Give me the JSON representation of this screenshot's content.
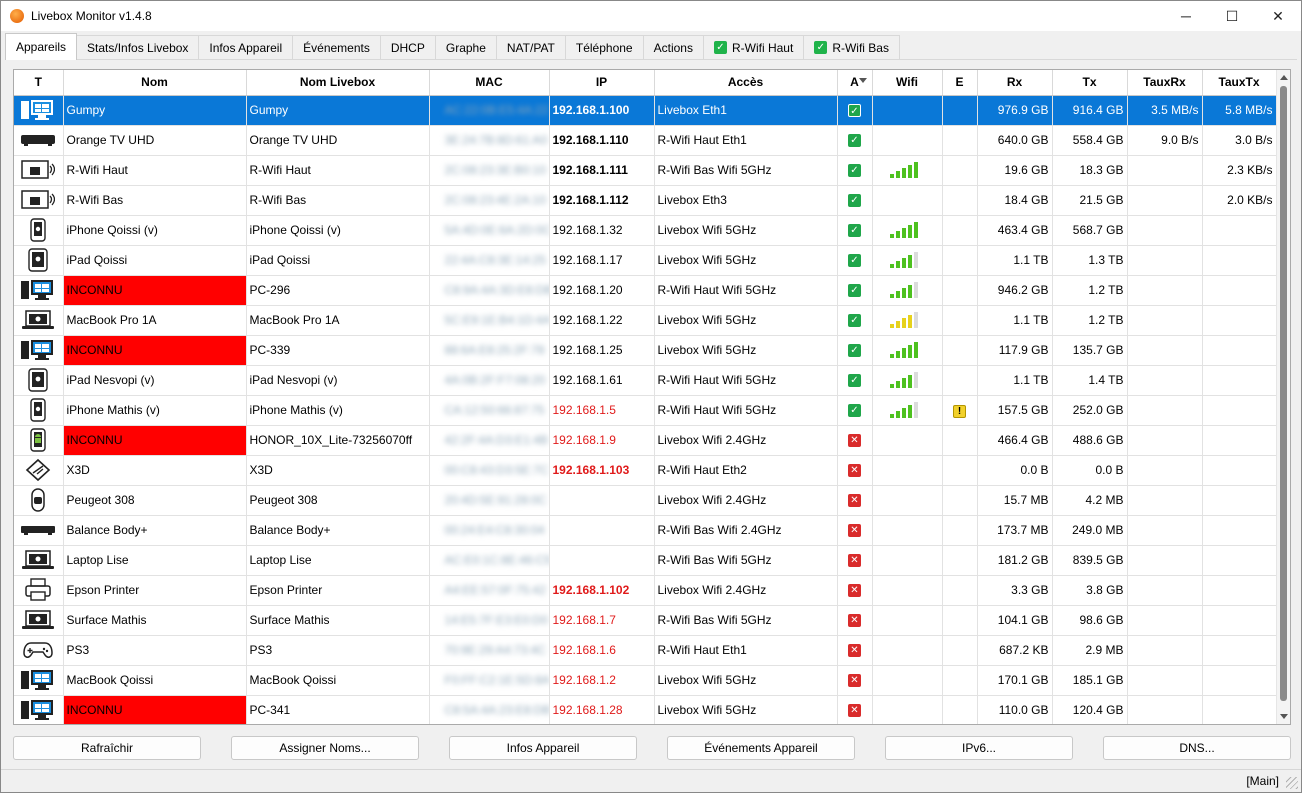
{
  "window": {
    "title": "Livebox Monitor v1.4.8",
    "minimize": "─",
    "maximize": "☐",
    "close": "✕"
  },
  "tabs": [
    {
      "label": "Appareils",
      "active": true
    },
    {
      "label": "Stats/Infos Livebox"
    },
    {
      "label": "Infos Appareil"
    },
    {
      "label": "Événements"
    },
    {
      "label": "DHCP"
    },
    {
      "label": "Graphe"
    },
    {
      "label": "NAT/PAT"
    },
    {
      "label": "Téléphone"
    },
    {
      "label": "Actions"
    },
    {
      "label": "R-Wifi Haut",
      "checked": true
    },
    {
      "label": "R-Wifi Bas",
      "checked": true
    }
  ],
  "table": {
    "columns": [
      "T",
      "Nom",
      "Nom Livebox",
      "MAC",
      "IP",
      "Accès",
      "A",
      "Wifi",
      "E",
      "Rx",
      "Tx",
      "TauxRx",
      "TauxTx"
    ],
    "rows": [
      {
        "icon": "pc",
        "nom": "Gumpy",
        "livebox": "Gumpy",
        "mac": "AC:22:0B:E5:4A:22",
        "ip": "192.168.1.100",
        "ipstyle": "bold",
        "acces": "Livebox Eth1",
        "a": "ok",
        "wifi": 0,
        "e": "",
        "rx": "976.9 GB",
        "tx": "916.4 GB",
        "trx": "3.5 MB/s",
        "ttx": "5.8 MB/s",
        "selected": true
      },
      {
        "icon": "tvbox",
        "nom": "Orange TV UHD",
        "livebox": "Orange TV UHD",
        "mac": "3E:24:7B:8D:61:A0",
        "ip": "192.168.1.110",
        "ipstyle": "bold",
        "acces": "R-Wifi Haut Eth1",
        "a": "ok",
        "wifi": 0,
        "e": "",
        "rx": "640.0 GB",
        "tx": "558.4 GB",
        "trx": "9.0 B/s",
        "ttx": "3.0 B/s"
      },
      {
        "icon": "repeater",
        "nom": "R-Wifi Haut",
        "livebox": "R-Wifi Haut",
        "mac": "2C:08:23:3E:B0:10",
        "ip": "192.168.1.111",
        "ipstyle": "bold",
        "acces": "R-Wifi Bas Wifi 5GHz",
        "a": "ok",
        "wifi": 5,
        "wific": "g",
        "e": "",
        "rx": "19.6 GB",
        "tx": "18.3 GB",
        "trx": "",
        "ttx": "2.3 KB/s"
      },
      {
        "icon": "repeater",
        "nom": "R-Wifi Bas",
        "livebox": "R-Wifi Bas",
        "mac": "2C:08:23:4E:2A:10",
        "ip": "192.168.1.112",
        "ipstyle": "bold",
        "acces": "Livebox Eth3",
        "a": "ok",
        "wifi": 0,
        "e": "",
        "rx": "18.4 GB",
        "tx": "21.5 GB",
        "trx": "",
        "ttx": "2.0 KB/s"
      },
      {
        "icon": "phone",
        "nom": "iPhone Qoissi (v)",
        "livebox": "iPhone Qoissi (v)",
        "mac": "5A:4D:0E:6A:2D:0C",
        "ip": "192.168.1.32",
        "ipstyle": "",
        "acces": "Livebox Wifi 5GHz",
        "a": "ok",
        "wifi": 5,
        "wific": "g",
        "e": "",
        "rx": "463.4 GB",
        "tx": "568.7 GB",
        "trx": "",
        "ttx": ""
      },
      {
        "icon": "tablet",
        "nom": "iPad Qoissi",
        "livebox": "iPad Qoissi",
        "mac": "22:4A:C8:3E:14:25",
        "ip": "192.168.1.17",
        "ipstyle": "",
        "acces": "Livebox Wifi 5GHz",
        "a": "ok",
        "wifi": 4,
        "wific": "g",
        "e": "",
        "rx": "1.1 TB",
        "tx": "1.3 TB",
        "trx": "",
        "ttx": ""
      },
      {
        "icon": "pc",
        "nom": "INCONNU",
        "livebox": "PC-296",
        "mac": "C8:9A:4A:3D:E8:DB",
        "ip": "192.168.1.20",
        "ipstyle": "",
        "acces": "R-Wifi Haut Wifi 5GHz",
        "a": "ok",
        "wifi": 4,
        "wific": "g",
        "e": "",
        "rx": "946.2 GB",
        "tx": "1.2 TB",
        "trx": "",
        "ttx": "",
        "unknown": true
      },
      {
        "icon": "laptop",
        "nom": "MacBook Pro 1A",
        "livebox": "MacBook Pro 1A",
        "mac": "5C:E9:1E:B4:1D:4A",
        "ip": "192.168.1.22",
        "ipstyle": "",
        "acces": "Livebox Wifi 5GHz",
        "a": "ok",
        "wifi": 4,
        "wific": "y",
        "e": "",
        "rx": "1.1 TB",
        "tx": "1.2 TB",
        "trx": "",
        "ttx": ""
      },
      {
        "icon": "pc",
        "nom": "INCONNU",
        "livebox": "PC-339",
        "mac": "88:6A:E8:25:2F:78",
        "ip": "192.168.1.25",
        "ipstyle": "",
        "acces": "Livebox Wifi 5GHz",
        "a": "ok",
        "wifi": 5,
        "wific": "g",
        "e": "",
        "rx": "117.9 GB",
        "tx": "135.7 GB",
        "trx": "",
        "ttx": "",
        "unknown": true
      },
      {
        "icon": "tablet",
        "nom": "iPad Nesvopi (v)",
        "livebox": "iPad Nesvopi (v)",
        "mac": "4A:0B:2F:F7:08:20",
        "ip": "192.168.1.61",
        "ipstyle": "",
        "acces": "R-Wifi Haut Wifi 5GHz",
        "a": "ok",
        "wifi": 4,
        "wific": "g",
        "e": "",
        "rx": "1.1 TB",
        "tx": "1.4 TB",
        "trx": "",
        "ttx": ""
      },
      {
        "icon": "phone",
        "nom": "iPhone Mathis (v)",
        "livebox": "iPhone Mathis (v)",
        "mac": "CA:12:50:66:87:75",
        "ip": "192.168.1.5",
        "ipstyle": "red",
        "acces": "R-Wifi Haut Wifi 5GHz",
        "a": "ok",
        "wifi": 4,
        "wific": "g",
        "e": "warn",
        "rx": "157.5 GB",
        "tx": "252.0 GB",
        "trx": "",
        "ttx": ""
      },
      {
        "icon": "android",
        "nom": "INCONNU",
        "livebox": "HONOR_10X_Lite-73256070ff",
        "mac": "42:2F:4A:D3:E1:4B",
        "ip": "192.168.1.9",
        "ipstyle": "red",
        "acces": "Livebox Wifi 2.4GHz",
        "a": "ko",
        "wifi": 0,
        "e": "",
        "rx": "466.4 GB",
        "tx": "488.6 GB",
        "trx": "",
        "ttx": "",
        "unknown": true
      },
      {
        "icon": "printer3d",
        "nom": "X3D",
        "livebox": "X3D",
        "mac": "00:C8:43:D3:5E:7C",
        "ip": "192.168.1.103",
        "ipstyle": "boldred",
        "acces": "R-Wifi Haut Eth2",
        "a": "ko",
        "wifi": 0,
        "e": "",
        "rx": "0.0 B",
        "tx": "0.0 B",
        "trx": "",
        "ttx": ""
      },
      {
        "icon": "car",
        "nom": "Peugeot 308",
        "livebox": "Peugeot 308",
        "mac": "20:4D:5E:91:28:0C",
        "ip": "",
        "ipstyle": "",
        "acces": "Livebox Wifi 2.4GHz",
        "a": "ko",
        "wifi": 0,
        "e": "",
        "rx": "15.7 MB",
        "tx": "4.2 MB",
        "trx": "",
        "ttx": ""
      },
      {
        "icon": "scale",
        "nom": "Balance Body+",
        "livebox": "Balance Body+",
        "mac": "00:24:E4:C8:30:04",
        "ip": "",
        "ipstyle": "",
        "acces": "R-Wifi Bas Wifi 2.4GHz",
        "a": "ko",
        "wifi": 0,
        "e": "",
        "rx": "173.7 MB",
        "tx": "249.0 MB",
        "trx": "",
        "ttx": ""
      },
      {
        "icon": "laptop",
        "nom": "Laptop Lise",
        "livebox": "Laptop Lise",
        "mac": "AC:E0:1C:8E:46:C5",
        "ip": "",
        "ipstyle": "",
        "acces": "R-Wifi Bas Wifi 5GHz",
        "a": "ko",
        "wifi": 0,
        "e": "",
        "rx": "181.2 GB",
        "tx": "839.5 GB",
        "trx": "",
        "ttx": ""
      },
      {
        "icon": "printer",
        "nom": "Epson Printer",
        "livebox": "Epson Printer",
        "mac": "A4:EE:57:0F:75:42",
        "ip": "192.168.1.102",
        "ipstyle": "boldred",
        "acces": "Livebox Wifi 2.4GHz",
        "a": "ko",
        "wifi": 0,
        "e": "",
        "rx": "3.3 GB",
        "tx": "3.8 GB",
        "trx": "",
        "ttx": ""
      },
      {
        "icon": "laptop",
        "nom": "Surface Mathis",
        "livebox": "Surface Mathis",
        "mac": "14:E5:7F:E3:E0:D0",
        "ip": "192.168.1.7",
        "ipstyle": "red",
        "acces": "R-Wifi Bas Wifi 5GHz",
        "a": "ko",
        "wifi": 0,
        "e": "",
        "rx": "104.1 GB",
        "tx": "98.6 GB",
        "trx": "",
        "ttx": ""
      },
      {
        "icon": "gamepad",
        "nom": "PS3",
        "livebox": "PS3",
        "mac": "70:9E:29:A4:73:4C",
        "ip": "192.168.1.6",
        "ipstyle": "red",
        "acces": "R-Wifi Haut Eth1",
        "a": "ko",
        "wifi": 0,
        "e": "",
        "rx": "687.2 KB",
        "tx": "2.9 MB",
        "trx": "",
        "ttx": ""
      },
      {
        "icon": "pc",
        "nom": "MacBook Qoissi",
        "livebox": "MacBook Qoissi",
        "mac": "F0:FF:C2:1E:5D:8A",
        "ip": "192.168.1.2",
        "ipstyle": "red",
        "acces": "Livebox Wifi 5GHz",
        "a": "ko",
        "wifi": 0,
        "e": "",
        "rx": "170.1 GB",
        "tx": "185.1 GB",
        "trx": "",
        "ttx": ""
      },
      {
        "icon": "pc",
        "nom": "INCONNU",
        "livebox": "PC-341",
        "mac": "C8:5A:4A:23:E8:DB",
        "ip": "192.168.1.28",
        "ipstyle": "red",
        "acces": "Livebox Wifi 5GHz",
        "a": "ko",
        "wifi": 0,
        "e": "",
        "rx": "110.0 GB",
        "tx": "120.4 GB",
        "trx": "",
        "ttx": "",
        "unknown": true
      }
    ]
  },
  "buttons": [
    "Rafraîchir",
    "Assigner Noms...",
    "Infos Appareil",
    "Événements Appareil",
    "IPv6...",
    "DNS..."
  ],
  "status": {
    "panel": "[Main]"
  },
  "colors": {
    "selection": "#0a78d7",
    "unknown": "#ff0000",
    "ok": "#1fa64a",
    "ko": "#d92b2b",
    "wifi_good": "#4ec11f",
    "wifi_mid": "#e6d21c"
  }
}
